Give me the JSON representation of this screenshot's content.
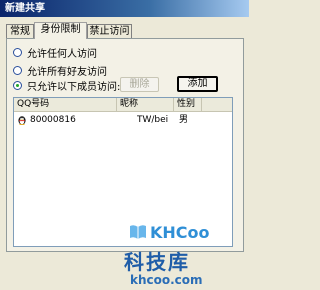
{
  "window": {
    "title": "新建共享"
  },
  "tabs": [
    {
      "label": "常规"
    },
    {
      "label": "身份限制"
    },
    {
      "label": "禁止访问"
    }
  ],
  "access": {
    "options": [
      {
        "label": "允许任何人访问",
        "checked": false
      },
      {
        "label": "允许所有好友访问",
        "checked": false
      },
      {
        "label": "只允许以下成员访问:",
        "checked": true
      }
    ],
    "remove_label": "删除",
    "add_label": "添加"
  },
  "members": {
    "columns": [
      "QQ号码",
      "昵称",
      "性别"
    ],
    "rows": [
      {
        "qq": "80000816",
        "nickname": "TW/bei",
        "gender": "男"
      }
    ]
  },
  "watermark": {
    "logo": "KHCoo",
    "title": "科技库",
    "url": "khcoo.com"
  }
}
